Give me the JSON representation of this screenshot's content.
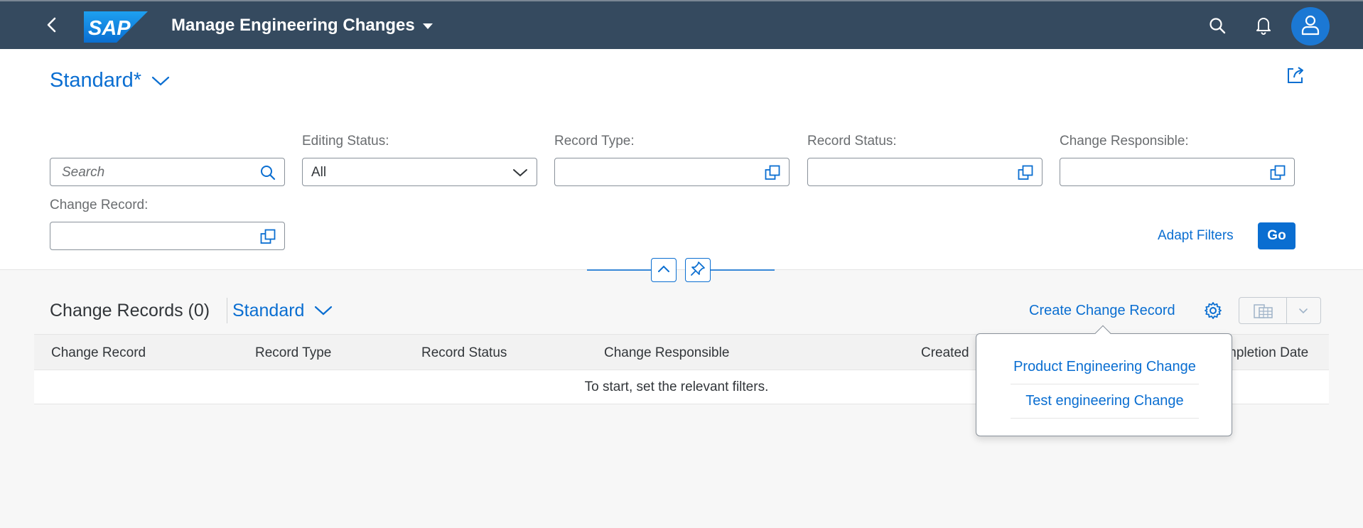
{
  "shell": {
    "title": "Manage Engineering Changes",
    "logo_text": "SAP",
    "icons": [
      "back-icon",
      "search-icon",
      "bell-icon",
      "user-icon"
    ]
  },
  "header": {
    "variant": "Standard*",
    "filters": {
      "search_placeholder": "Search",
      "editing_status_label": "Editing Status:",
      "editing_status_value": "All",
      "record_type_label": "Record Type:",
      "record_status_label": "Record Status:",
      "change_responsible_label": "Change Responsible:",
      "change_record_label": "Change Record:"
    },
    "adapt_filters": "Adapt Filters",
    "go": "Go"
  },
  "table": {
    "title": "Change Records (0)",
    "variant": "Standard",
    "create_label": "Create Change Record",
    "columns": [
      "Change Record",
      "Record Type",
      "Record Status",
      "Change Responsible",
      "Created",
      "mpletion Date"
    ],
    "empty_text": "To start, set the relevant filters."
  },
  "popover": {
    "items": [
      "Product Engineering Change",
      "Test engineering Change"
    ]
  },
  "colors": {
    "shell": "#354a5f",
    "accent": "#0a6ed1",
    "avatar": "#1b78d4"
  }
}
